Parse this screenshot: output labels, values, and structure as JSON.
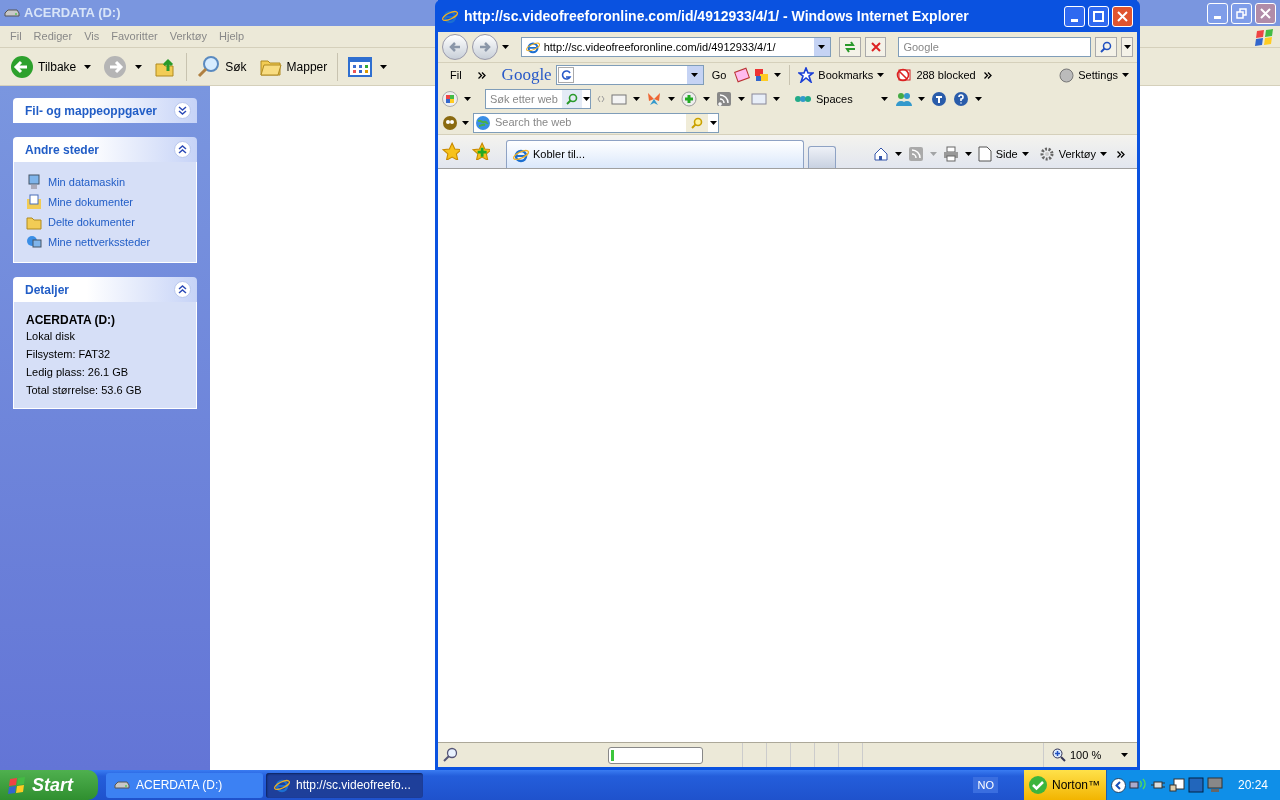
{
  "explorer": {
    "title": "ACERDATA (D:)",
    "active": false,
    "menu": [
      "Fil",
      "Rediger",
      "Vis",
      "Favoritter",
      "Verktøy",
      "Hjelp"
    ],
    "toolbar": [
      {
        "kind": "back",
        "label": "Tilbake"
      },
      {
        "kind": "forward"
      },
      {
        "kind": "up"
      },
      {
        "kind": "search",
        "label": "Søk"
      },
      {
        "kind": "folders",
        "label": "Mapper"
      },
      {
        "kind": "views"
      }
    ],
    "panels": [
      {
        "title": "Fil- og mappeoppgaver",
        "expanded": false
      },
      {
        "title": "Andre steder",
        "expanded": true,
        "items": [
          {
            "kind": "computer",
            "label": "Min datamaskin"
          },
          {
            "kind": "documents",
            "label": "Mine dokumenter"
          },
          {
            "kind": "folder",
            "label": "Delte dokumenter"
          },
          {
            "kind": "network",
            "label": "Mine nettverkssteder"
          }
        ]
      },
      {
        "title": "Detaljer",
        "expanded": true,
        "heading": "ACERDATA (D:)",
        "lines": [
          "Lokal disk",
          "Filsystem: FAT32",
          "Ledig plass: 26.1 GB",
          "Total størrelse: 53.6 GB"
        ]
      }
    ]
  },
  "browser": {
    "title": "http://sc.videofreeforonline.com/id/4912933/4/1/ - Windows Internet Explorer",
    "active": true,
    "address": "http://sc.videofreeforonline.com/id/4912933/4/1/",
    "search": {
      "placeholder": "Google"
    },
    "menu_item": "Fil",
    "google_bar": {
      "logo": "Google",
      "go": "Go",
      "bookmarks": "Bookmarks",
      "blocked": "288 blocked",
      "settings": "Settings"
    },
    "msn_bar": {
      "placeholder": "Søk etter web",
      "spaces": "Spaces"
    },
    "third_bar": {
      "placeholder": "Search the web"
    },
    "tabs": [
      {
        "label": "Kobler til...",
        "selected": true
      }
    ],
    "command_bar": {
      "page": "Side",
      "tools": "Verktøy"
    },
    "status": {
      "level": 0.03,
      "zoom": "100 %"
    }
  },
  "taskbar": {
    "start": "Start",
    "tasks": [
      {
        "kind": "drive",
        "label": "ACERDATA (D:)",
        "selected": false
      },
      {
        "kind": "ie",
        "label": "http://sc.videofreefo...",
        "selected": true
      }
    ],
    "language": "NO",
    "norton": "Norton™",
    "clock": "20:24"
  }
}
